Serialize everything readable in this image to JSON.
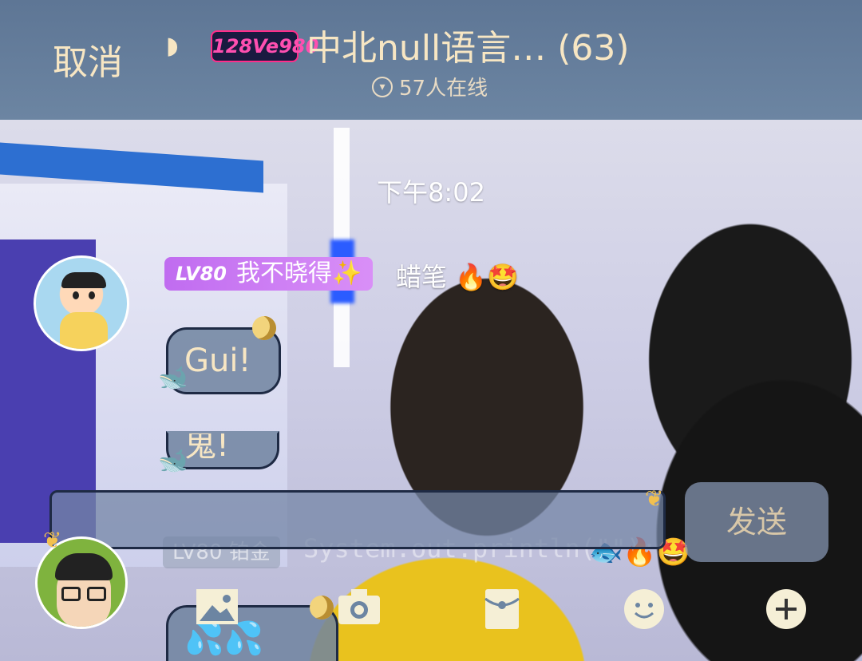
{
  "header": {
    "cancel_label": "取消",
    "badge_text": "128Ve980",
    "group_title": "中北null语言… (63)",
    "online_text": "57人在线"
  },
  "chat": {
    "timestamp": "下午8:02",
    "message1": {
      "level": "LV80",
      "nickname": "我不晓得✨",
      "sender_name": "蜡笔 🔥🤩",
      "bubble1": "Gui!",
      "bubble2": "鬼!"
    },
    "message2": {
      "level": "LV80",
      "title": "铂金",
      "text": "System.out.println(\"\");",
      "emoji": "🐟🔥🤩",
      "bubble": "💦💦"
    }
  },
  "composer": {
    "send_label": "发送"
  },
  "toolbar": {
    "icons": [
      "image-icon",
      "camera-icon",
      "red-packet-icon",
      "emoji-icon",
      "plus-icon"
    ]
  },
  "colors": {
    "header_bg": "#6c85a2",
    "accent_text": "#f7e6c3",
    "level_badge": "#c06cf0",
    "bubble_bg": "#7084a0"
  }
}
